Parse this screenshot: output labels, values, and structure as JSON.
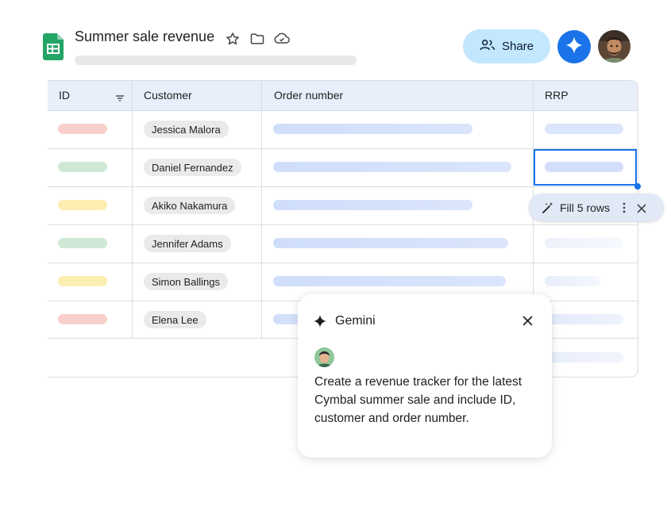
{
  "header": {
    "title": "Summer sale revenue",
    "share_label": "Share"
  },
  "table": {
    "columns": [
      "ID",
      "Customer",
      "Order number",
      "RRP"
    ],
    "customers": [
      "Jessica Malora",
      "Daniel Fernandez",
      "Akiko Nakamura",
      "Jennifer Adams",
      "Simon Ballings",
      "Elena Lee"
    ]
  },
  "colors": {
    "id_pills": [
      "#f8cfcb",
      "#cfe8d6",
      "#fceeb0",
      "#cfe8d6",
      "#fceeb0",
      "#f8cfcb"
    ],
    "accent": "#1a73e8",
    "share_bg": "#c2e7ff"
  },
  "fill_chip": {
    "label": "Fill 5 rows"
  },
  "gemini": {
    "title": "Gemini",
    "message": "Create a revenue tracker for the latest Cymbal summer sale and include ID, customer and order number."
  },
  "icons": [
    "sheets-logo-icon",
    "star-icon",
    "folder-icon",
    "cloud-icon",
    "people-icon",
    "gemini-spark-icon",
    "filter-icon",
    "magic-wand-icon",
    "more-vert-icon",
    "close-icon"
  ]
}
